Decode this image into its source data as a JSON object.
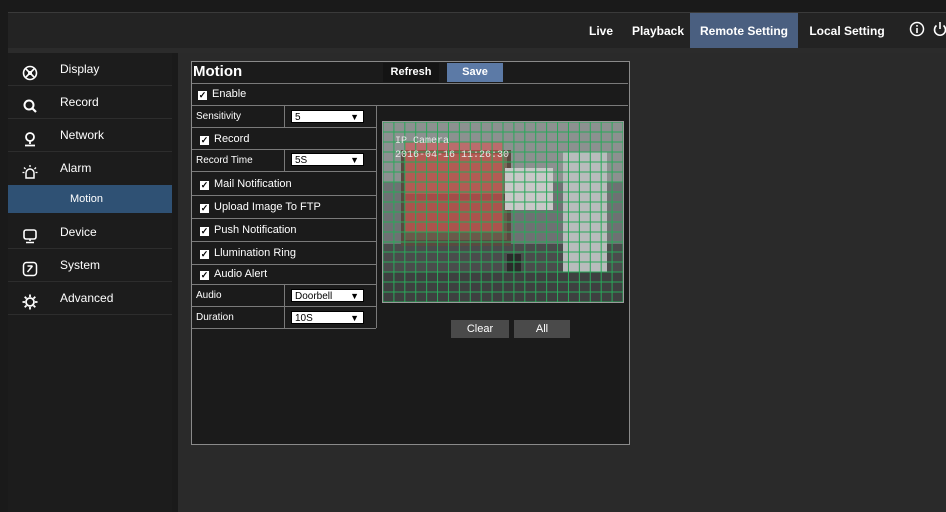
{
  "topnav": {
    "items": [
      {
        "label": "Live",
        "active": false
      },
      {
        "label": "Playback",
        "active": false
      },
      {
        "label": "Remote Setting",
        "active": true
      },
      {
        "label": "Local Setting",
        "active": false
      }
    ],
    "icons": [
      "info-icon",
      "power-icon"
    ],
    "active_color": "#4a5f80"
  },
  "sidebar": {
    "items": [
      {
        "label": "Display",
        "icon": "display-icon"
      },
      {
        "label": "Record",
        "icon": "record-icon"
      },
      {
        "label": "Network",
        "icon": "network-icon"
      },
      {
        "label": "Alarm",
        "icon": "alarm-icon"
      },
      {
        "label": "Motion",
        "sub": true,
        "active": true
      },
      {
        "label": "Device",
        "icon": "device-icon"
      },
      {
        "label": "System",
        "icon": "system-icon"
      },
      {
        "label": "Advanced",
        "icon": "advanced-icon"
      }
    ],
    "active_color": "#2f5174"
  },
  "panel": {
    "title": "Motion",
    "refresh_label": "Refresh",
    "save_label": "Save",
    "enable_label": "Enable",
    "sensitivity": {
      "label": "Sensitivity",
      "value": "5"
    },
    "record_label": "Record",
    "record_time": {
      "label": "Record Time",
      "value": "5S"
    },
    "mail_label": "Mail Notification",
    "ftp_label": "Upload Image To FTP",
    "push_label": "Push Notification",
    "ring_label": "Llumination Ring",
    "audio_alert_label": "Audio Alert",
    "audio": {
      "label": "Audio",
      "value": "Doorbell"
    },
    "duration": {
      "label": "Duration",
      "value": "10S"
    },
    "clear_label": "Clear",
    "all_label": "All"
  },
  "camera": {
    "name": "IP Camera",
    "timestamp": "2016-04-16 11:26:30",
    "grid_color": "#2aa85a",
    "region_color": "#e05050"
  }
}
